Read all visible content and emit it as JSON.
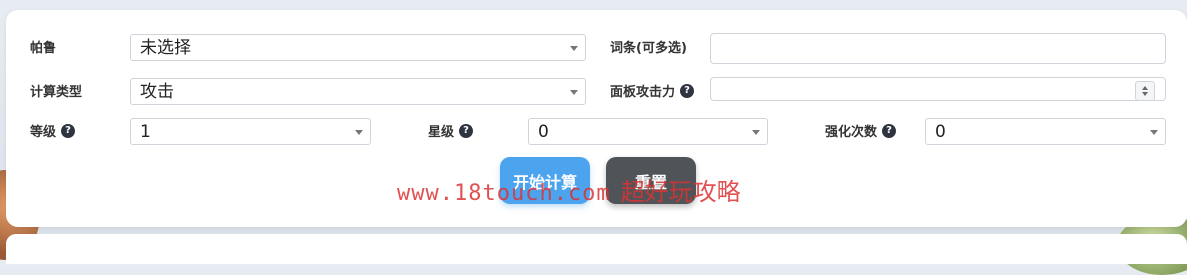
{
  "form": {
    "pal": {
      "label": "帕鲁",
      "value": "未选择"
    },
    "affix": {
      "label": "词条(可多选)",
      "value": ""
    },
    "calc_type": {
      "label": "计算类型",
      "value": "攻击"
    },
    "panel_attack": {
      "label": "面板攻击力",
      "help": "?",
      "value": ""
    },
    "level": {
      "label": "等级",
      "help": "?",
      "value": "1"
    },
    "star": {
      "label": "星级",
      "help": "?",
      "value": "0"
    },
    "enhance": {
      "label": "强化次数",
      "help": "?",
      "value": "0"
    }
  },
  "buttons": {
    "calculate": "开始计算",
    "reset": "重置"
  },
  "watermark": {
    "url": "www.18touch.com",
    "text": "超好玩攻略"
  }
}
